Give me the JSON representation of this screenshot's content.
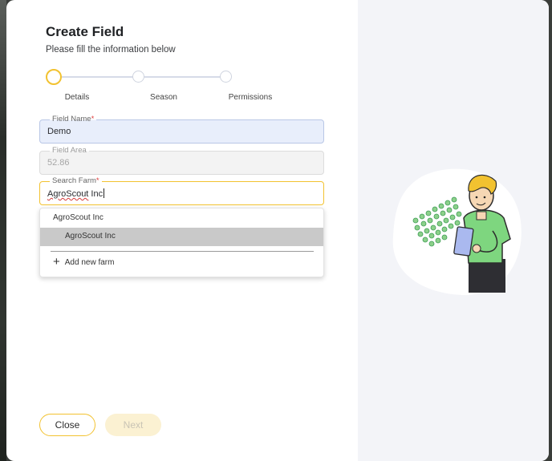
{
  "modal": {
    "title": "Create Field",
    "subtitle": "Please fill the information below"
  },
  "stepper": {
    "steps": [
      {
        "label": "Details",
        "state": "active"
      },
      {
        "label": "Season",
        "state": "inactive"
      },
      {
        "label": "Permissions",
        "state": "inactive"
      }
    ]
  },
  "form": {
    "field_name": {
      "label": "Field Name",
      "required_mark": "*",
      "value": "Demo"
    },
    "field_area": {
      "label": "Field Area",
      "value": "52.86",
      "disabled": true
    },
    "search_farm": {
      "label": "Search Farm",
      "required_mark": "*",
      "value": "AgroScout Inc",
      "spellcheck_word": "AgroScout"
    }
  },
  "dropdown": {
    "group_label": "AgroScout Inc",
    "options": [
      "AgroScout Inc"
    ],
    "add_new_label": "Add new farm"
  },
  "footer": {
    "close_label": "Close",
    "next_label": "Next"
  },
  "colors": {
    "accent": "#f2c230",
    "field_active_bg": "#e8eefb",
    "right_panel_bg": "#f3f4f8",
    "option_highlight": "#c9c9c9"
  },
  "icons": {
    "add": "plus-icon",
    "illustration": "farmer-with-clipboard-illustration"
  }
}
